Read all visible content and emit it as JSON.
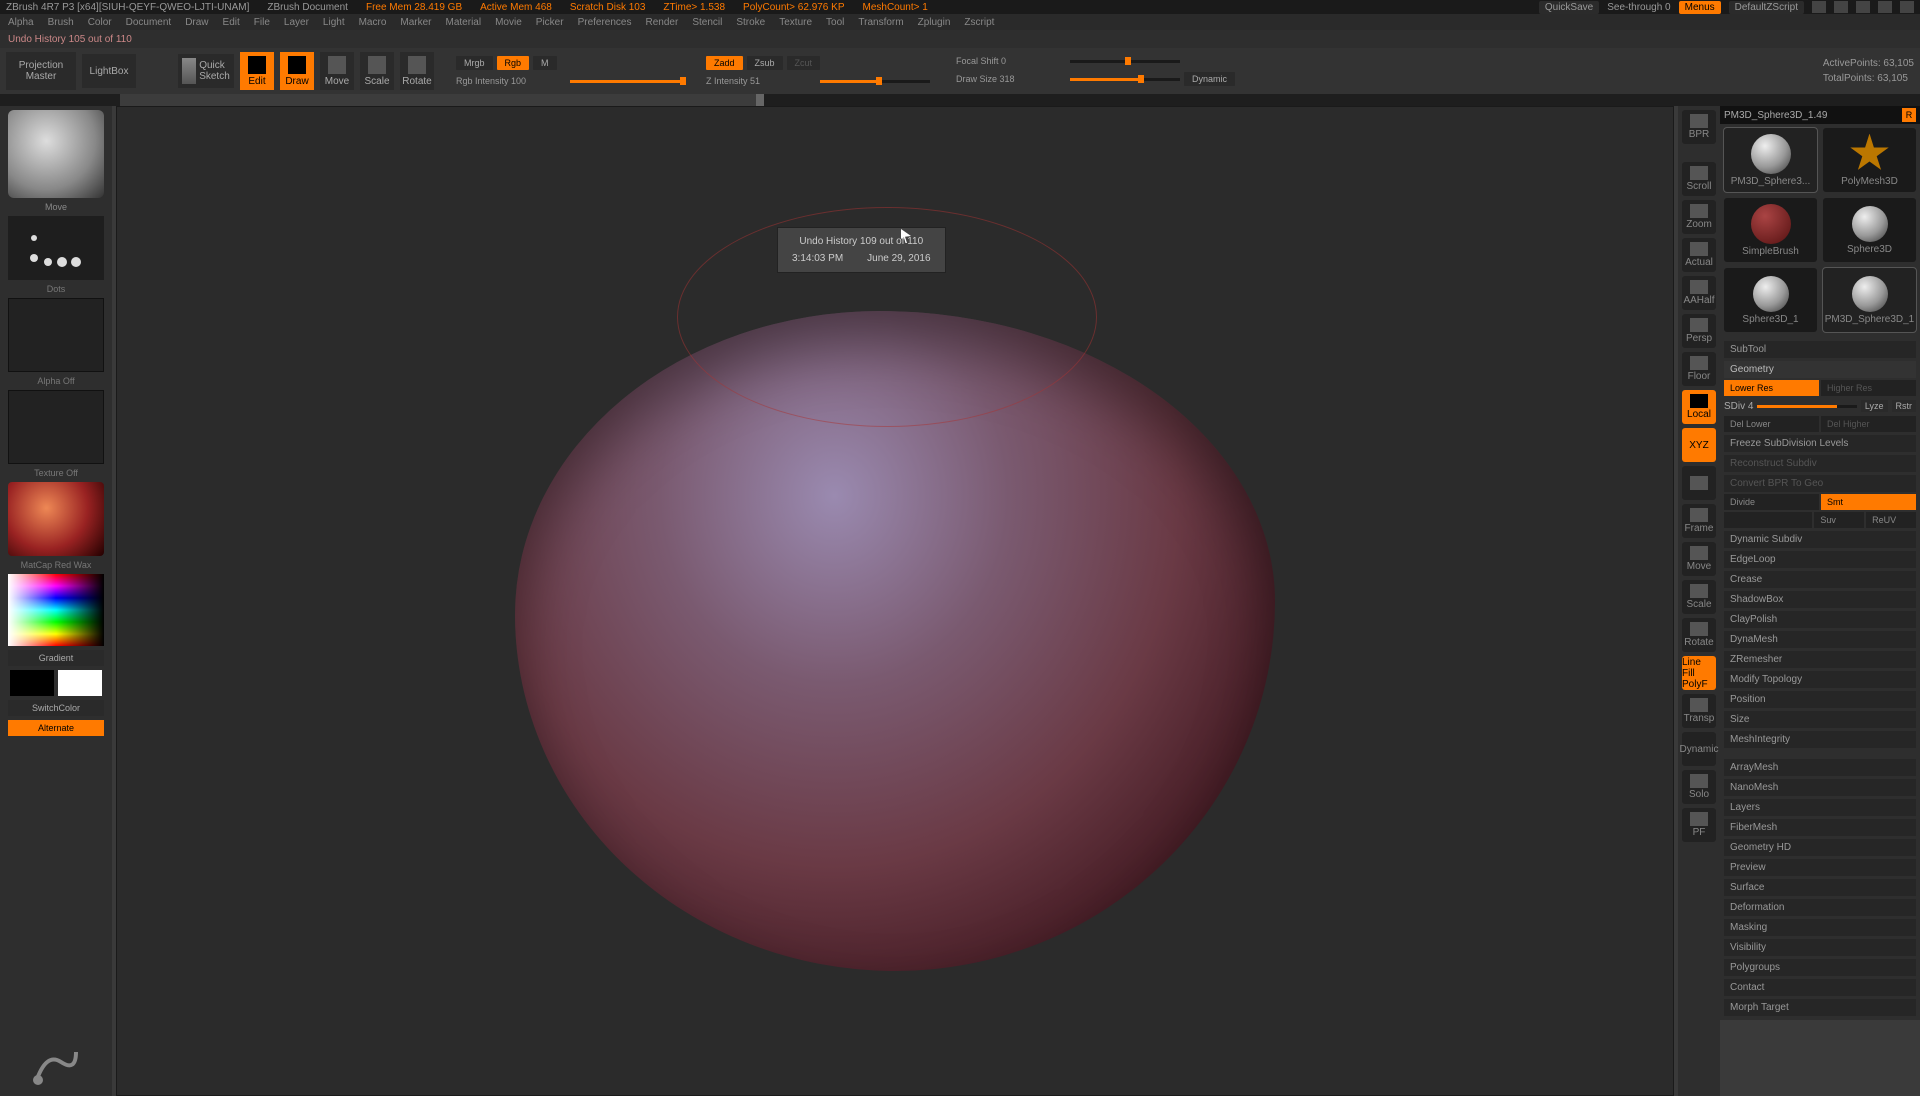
{
  "title": {
    "app": "ZBrush 4R7 P3 [x64][SIUH-QEYF-QWEO-LJTI-UNAM]",
    "docname": "ZBrush Document",
    "freemem": "Free Mem 28.419 GB",
    "activemem": "Active Mem 468",
    "scratch": "Scratch Disk 103",
    "ztime": "ZTime> 1.538",
    "polycount": "PolyCount> 62.976 KP",
    "meshcount": "MeshCount> 1",
    "quicksave": "QuickSave",
    "seethrough": "See-through  0",
    "menus": "Menus",
    "script": "DefaultZScript"
  },
  "menubar": [
    "Alpha",
    "Brush",
    "Color",
    "Document",
    "Draw",
    "Edit",
    "File",
    "Layer",
    "Light",
    "Macro",
    "Marker",
    "Material",
    "Movie",
    "Picker",
    "Preferences",
    "Render",
    "Stencil",
    "Stroke",
    "Texture",
    "Tool",
    "Transform",
    "Zplugin",
    "Zscript"
  ],
  "status": "Undo History 105 out of 110",
  "toolbar": {
    "proj1": "Projection",
    "proj2": "Master",
    "lightbox": "LightBox",
    "quicksketch": "Quick\nSketch",
    "modes": [
      "Edit",
      "Draw",
      "Move",
      "Scale",
      "Rotate"
    ],
    "mrgb": "Mrgb",
    "rgb": "Rgb",
    "m": "M",
    "rgbint": "Rgb Intensity 100",
    "zadd": "Zadd",
    "zsub": "Zsub",
    "zcut": "Zcut",
    "zint": "Z Intensity 51",
    "focal": "Focal Shift 0",
    "drawsize": "Draw Size 318",
    "dynamic": "Dynamic",
    "active": "ActivePoints: 63,105",
    "total": "TotalPoints: 63,105"
  },
  "tooltip": {
    "line1": "Undo History 109 out of 110",
    "time": "3:14:03 PM",
    "date": "June 29, 2016"
  },
  "left": {
    "brushlabel": "Move",
    "dotslabel": "Dots",
    "alphaoff": "Alpha Off",
    "texoff": "Texture Off",
    "matname": "MatCap Red Wax",
    "gradient": "Gradient",
    "switch": "SwitchColor",
    "alternate": "Alternate"
  },
  "rquick": [
    "BPR",
    "",
    "Scroll",
    "Zoom",
    "Actual",
    "AAHalf",
    "Persp",
    "Floor",
    "Local",
    "XYZ",
    "",
    "Frame",
    "Move",
    "Scale",
    "Rotate",
    "Line Fill PolyF",
    "Transp",
    "Dynamic",
    "Solo",
    "PF"
  ],
  "thumbs": {
    "items": [
      "PM3D_Sphere3...",
      "PolyMesh3D",
      "SimpleBrush",
      "Sphere3D",
      "Sphere3D_1",
      "PM3D_Sphere3D_1"
    ],
    "header": "PM3D_Sphere3D_1.49"
  },
  "insp": {
    "subtool": "SubTool",
    "geometry": "Geometry",
    "lowerres": "Lower Res",
    "higherres": "Higher Res",
    "sdiv": "SDiv 4",
    "lyze": "Lyze",
    "rstr": "Rstr",
    "dellower": "Del Lower",
    "delhigher": "Del Higher",
    "freeze": "Freeze SubDivision Levels",
    "reconstruct": "Reconstruct Subdiv",
    "convert": "Convert BPR To Geo",
    "divide": "Divide",
    "smt": "Smt",
    "suv": "Suv",
    "reuv": "ReUV",
    "sections": [
      "Dynamic Subdiv",
      "EdgeLoop",
      "Crease",
      "ShadowBox",
      "ClayPolish",
      "DynaMesh",
      "ZRemesher",
      "Modify Topology",
      "Position",
      "Size",
      "MeshIntegrity"
    ],
    "more": [
      "ArrayMesh",
      "NanoMesh",
      "Layers",
      "FiberMesh",
      "Geometry HD",
      "Preview",
      "Surface",
      "Deformation",
      "Masking",
      "Visibility",
      "Polygroups",
      "Contact",
      "Morph Target"
    ]
  }
}
